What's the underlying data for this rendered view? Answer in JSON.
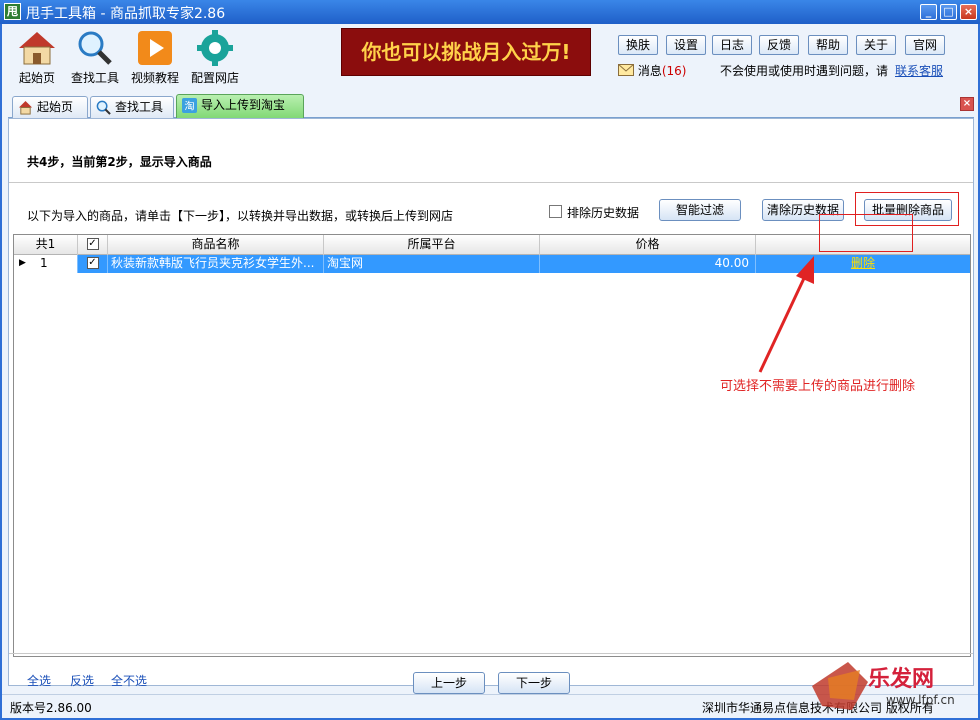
{
  "window": {
    "title": "甩手工具箱 - 商品抓取专家2.86",
    "app_icon_text": "甩"
  },
  "toolbar": {
    "items": [
      {
        "label": "起始页",
        "icon": "home-icon"
      },
      {
        "label": "查找工具",
        "icon": "magnifier-icon"
      },
      {
        "label": "视频教程",
        "icon": "play-icon"
      },
      {
        "label": "配置网店",
        "icon": "gear-icon"
      }
    ],
    "banner": "你也可以挑战月入过万!",
    "buttons": [
      "换肤",
      "设置",
      "日志",
      "反馈",
      "帮助",
      "关于",
      "官网"
    ],
    "message_label": "消息",
    "message_count": "(16)",
    "help_text": "不会使用或使用时遇到问题，请",
    "contact_link": "联系客服"
  },
  "tabs": [
    {
      "label": "起始页",
      "icon": "home-icon",
      "active": false
    },
    {
      "label": "查找工具",
      "icon": "magnifier-icon",
      "active": false
    },
    {
      "label": "导入上传到淘宝",
      "icon": "taobao-icon",
      "active": true
    }
  ],
  "content": {
    "step_text": "共4步，当前第2步，显示导入商品",
    "intro_text": "以下为导入的商品，请单击【下一步】，以转换并导出数据，或转换后上传到网店",
    "exclude_history_label": "排除历史数据",
    "smart_filter_label": "智能过滤",
    "clear_history_label": "清除历史数据",
    "batch_delete_label": "批量删除商品"
  },
  "grid": {
    "headers": {
      "count": "共1",
      "name": "商品名称",
      "platform": "所属平台",
      "price": "价格"
    },
    "rows": [
      {
        "index": "1",
        "checked": true,
        "name": "秋装新款韩版飞行员夹克衫女学生外...",
        "platform": "淘宝网",
        "price": "40.00",
        "action": "删除"
      }
    ]
  },
  "annotation": "可选择不需要上传的商品进行删除",
  "footer": {
    "select_all": "全选",
    "invert": "反选",
    "select_none": "全不选",
    "prev": "上一步",
    "next": "下一步"
  },
  "status": {
    "version": "版本号2.86.00",
    "company": "深圳市华通易点信息技术有限公司 版权所有"
  },
  "watermark": {
    "text": "乐发网",
    "url": "www.lfpf.cn"
  },
  "colors": {
    "titlebar": "#1f5fc8",
    "selected_row": "#3399ff",
    "banner_bg": "#8b0d0d",
    "banner_text": "#ffd24a",
    "annotation": "#e02424"
  }
}
